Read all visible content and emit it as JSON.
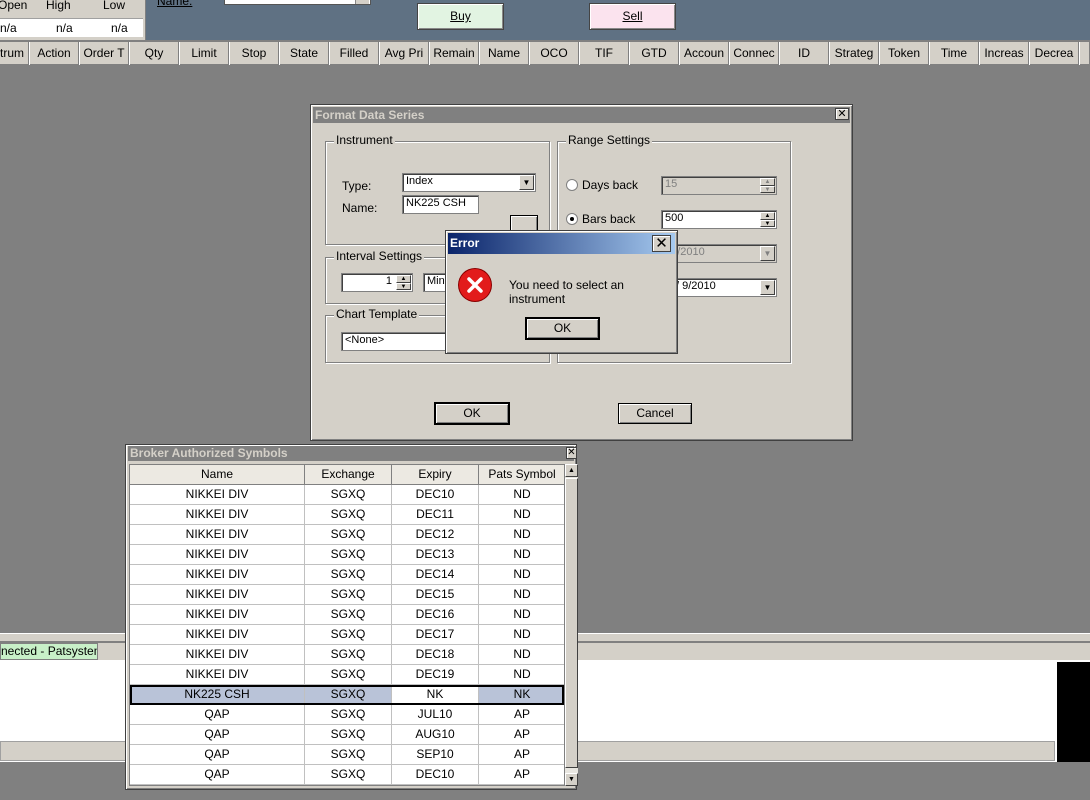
{
  "quote": {
    "headers": [
      "Open",
      "High",
      "Low"
    ],
    "values": [
      "n/a",
      "n/a",
      "n/a"
    ]
  },
  "order_entry": {
    "name_label": "Name:",
    "buy_label": "Buy",
    "sell_label": "Sell"
  },
  "order_grid": {
    "columns": [
      "trum",
      "Action",
      "Order T",
      "Qty",
      "Limit",
      "Stop",
      "State",
      "Filled",
      "Avg Pri",
      "Remain",
      "Name",
      "OCO",
      "TIF",
      "GTD",
      "Accoun",
      "Connec",
      "ID",
      "Strateg",
      "Token",
      "Time",
      "Increas",
      "Decrea"
    ]
  },
  "format_dialog": {
    "title": "Format Data Series",
    "instrument_group": "Instrument",
    "type_label": "Type:",
    "type_value": "Index",
    "name_label": "Name:",
    "name_value": "NK225 CSH",
    "interval_group": "Interval Settings",
    "interval_value": "1",
    "interval_unit": "Minu",
    "template_group": "Chart Template",
    "template_value": "<None>",
    "range_group": "Range Settings",
    "days_back_label": "Days back",
    "days_back_value": "15",
    "bars_back_label": "Bars back",
    "bars_back_value": "500",
    "from_date": "24/2010",
    "to_date": "/ 9/2010",
    "ok_label": "OK",
    "cancel_label": "Cancel"
  },
  "error_dialog": {
    "title": "Error",
    "message": "You need to select an instrument",
    "ok_label": "OK"
  },
  "symbols_panel": {
    "title": "Broker Authorized Symbols",
    "columns": [
      "Name",
      "Exchange",
      "Expiry",
      "Pats Symbol"
    ],
    "rows": [
      [
        "NIKKEI DIV",
        "SGXQ",
        "DEC10",
        "ND"
      ],
      [
        "NIKKEI DIV",
        "SGXQ",
        "DEC11",
        "ND"
      ],
      [
        "NIKKEI DIV",
        "SGXQ",
        "DEC12",
        "ND"
      ],
      [
        "NIKKEI DIV",
        "SGXQ",
        "DEC13",
        "ND"
      ],
      [
        "NIKKEI DIV",
        "SGXQ",
        "DEC14",
        "ND"
      ],
      [
        "NIKKEI DIV",
        "SGXQ",
        "DEC15",
        "ND"
      ],
      [
        "NIKKEI DIV",
        "SGXQ",
        "DEC16",
        "ND"
      ],
      [
        "NIKKEI DIV",
        "SGXQ",
        "DEC17",
        "ND"
      ],
      [
        "NIKKEI DIV",
        "SGXQ",
        "DEC18",
        "ND"
      ],
      [
        "NIKKEI DIV",
        "SGXQ",
        "DEC19",
        "ND"
      ],
      [
        "NK225 CSH",
        "SGXQ",
        "NK",
        "NK"
      ],
      [
        "QAP",
        "SGXQ",
        "JUL10",
        "AP"
      ],
      [
        "QAP",
        "SGXQ",
        "AUG10",
        "AP"
      ],
      [
        "QAP",
        "SGXQ",
        "SEP10",
        "AP"
      ],
      [
        "QAP",
        "SGXQ",
        "DEC10",
        "AP"
      ]
    ],
    "selected_row": 10
  },
  "status": {
    "connection_text": "nected - Patsystems"
  },
  "colors": {
    "desktop": "#808080",
    "top_bar": "#5f7183",
    "buy": "#e2f4e2",
    "sell": "#fbe3ee",
    "error_red": "#e21b1b",
    "selection": "#b9c3d8",
    "connected": "#c8f0c8"
  }
}
